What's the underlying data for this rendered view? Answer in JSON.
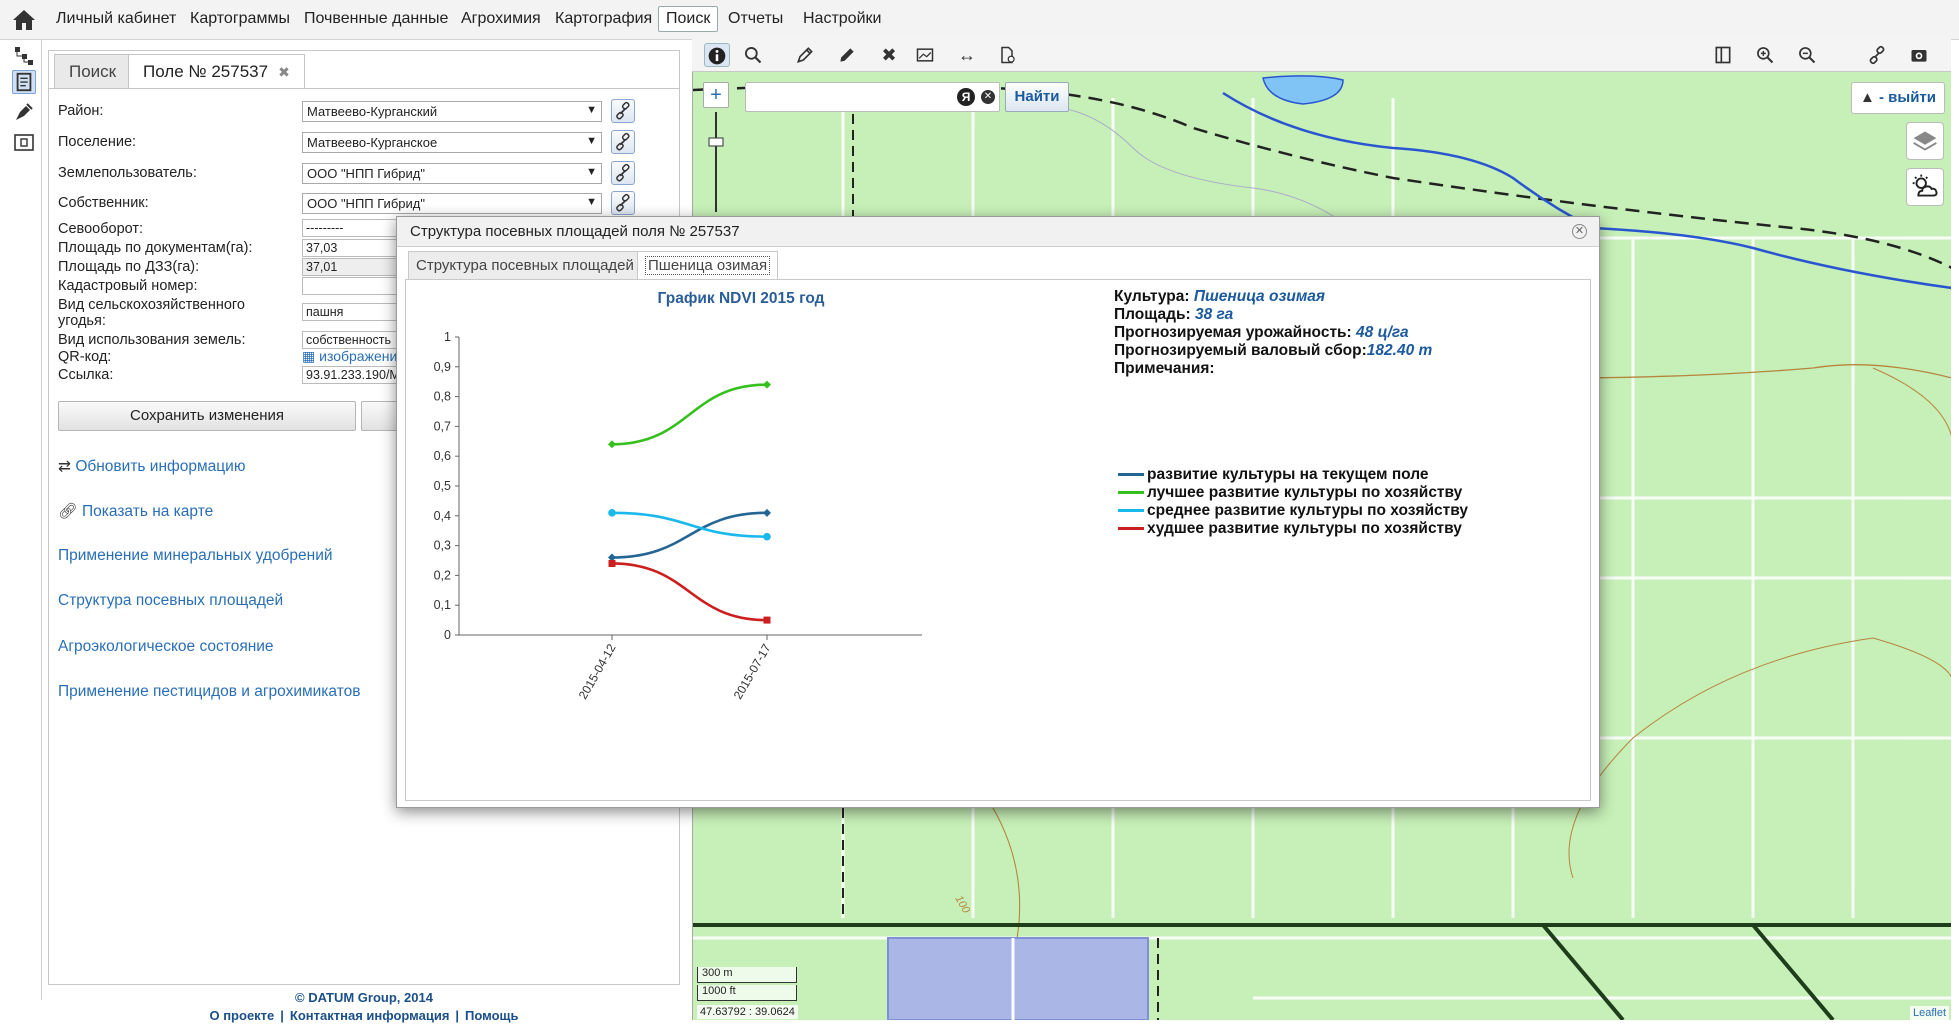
{
  "menu": {
    "items": [
      "Личный кабинет",
      "Картограммы",
      "Почвенные данные",
      "Агрохимия",
      "Картография",
      "Поиск",
      "Отчеты",
      "Настройки"
    ],
    "active": "Поиск"
  },
  "panel": {
    "tabs": [
      {
        "label": "Поиск"
      },
      {
        "label": "Поле № 257537"
      }
    ],
    "fields": {
      "district_label": "Район:",
      "district_value": "Матвеево-Курганский",
      "settlement_label": "Поселение:",
      "settlement_value": "Матвеево-Курганское",
      "landuser_label": "Землепользователь:",
      "landuser_value": "ООО \"НПП Гибрид\"",
      "owner_label": "Собственник:",
      "owner_value": "ООО \"НПП Гибрид\"",
      "rotation_label": "Севооборот:",
      "rotation_value": "---------",
      "area_docs_label": "Площадь по документам(га):",
      "area_docs_value": "37,03",
      "area_dzz_label": "Площадь по ДЗЗ(га):",
      "area_dzz_value": "37,01",
      "cadastre_label": "Кадастровый номер:",
      "cadastre_value": "",
      "land_type_label": "Вид сельскохозяйственного угодья:",
      "land_type_value": "пашня",
      "land_use_label": "Вид использования земель:",
      "land_use_value": "собственность",
      "qr_label": "QR-код:",
      "qr_value": "изображение",
      "link_label": "Ссылка:",
      "link_value": "93.91.233.190/M"
    },
    "save_button": "Сохранить изменения",
    "links": [
      "Обновить информацию",
      "Показать на карте",
      "Применение минеральных удобрений",
      "Структура посевных площадей",
      "Агроэкологическое состояние",
      "Применение пестицидов и агрохимикатов"
    ]
  },
  "footer": {
    "copyright": "© DATUM Group, 2014",
    "about": "О проекте",
    "contacts": "Контактная информация",
    "help": "Помощь"
  },
  "map": {
    "search_placeholder": "",
    "find_button": "Найти",
    "logout": "- выйти",
    "scale_m": "300 m",
    "scale_ft": "1000 ft",
    "coords": "47.63792 : 39.0624",
    "attribution": "Leaflet",
    "contour_label": "100"
  },
  "dialog": {
    "title": "Структура посевных площадей поля № 257537",
    "tabs": [
      "Структура посевных площадей",
      "Пшеница озимая"
    ],
    "info": {
      "culture_label": "Культура:",
      "culture_value": "Пшеница озимая",
      "area_label": "Площадь:",
      "area_value": "38 га",
      "yield_label": "Прогнозируемая урожайность:",
      "yield_value": "48 ц/га",
      "gross_label": "Прогнозируемый валовый сбор:",
      "gross_value": "182.40 т",
      "notes_label": "Примечания:"
    }
  },
  "chart_data": {
    "type": "line",
    "title": "График NDVI 2015 год",
    "categories": [
      "2015-04-12",
      "2015-07-17"
    ],
    "ylim": [
      0,
      1
    ],
    "yticks": [
      "0",
      "0,1",
      "0,2",
      "0,3",
      "0,4",
      "0,5",
      "0,6",
      "0,7",
      "0,8",
      "0,9",
      "1"
    ],
    "series": [
      {
        "name": "развитие культуры на текущем поле",
        "color": "#236593",
        "marker": "diamond",
        "values": [
          0.26,
          0.41
        ]
      },
      {
        "name": "лучшее развитие культуры по хозяйству",
        "color": "#36c01d",
        "marker": "diamond",
        "values": [
          0.64,
          0.84
        ]
      },
      {
        "name": "среднее развитие культуры по хозяйству",
        "color": "#1bb8ec",
        "marker": "circle",
        "values": [
          0.41,
          0.33
        ]
      },
      {
        "name": "худшее развитие культуры по хозяйству",
        "color": "#cc1f1f",
        "marker": "square",
        "values": [
          0.24,
          0.05
        ]
      }
    ]
  }
}
